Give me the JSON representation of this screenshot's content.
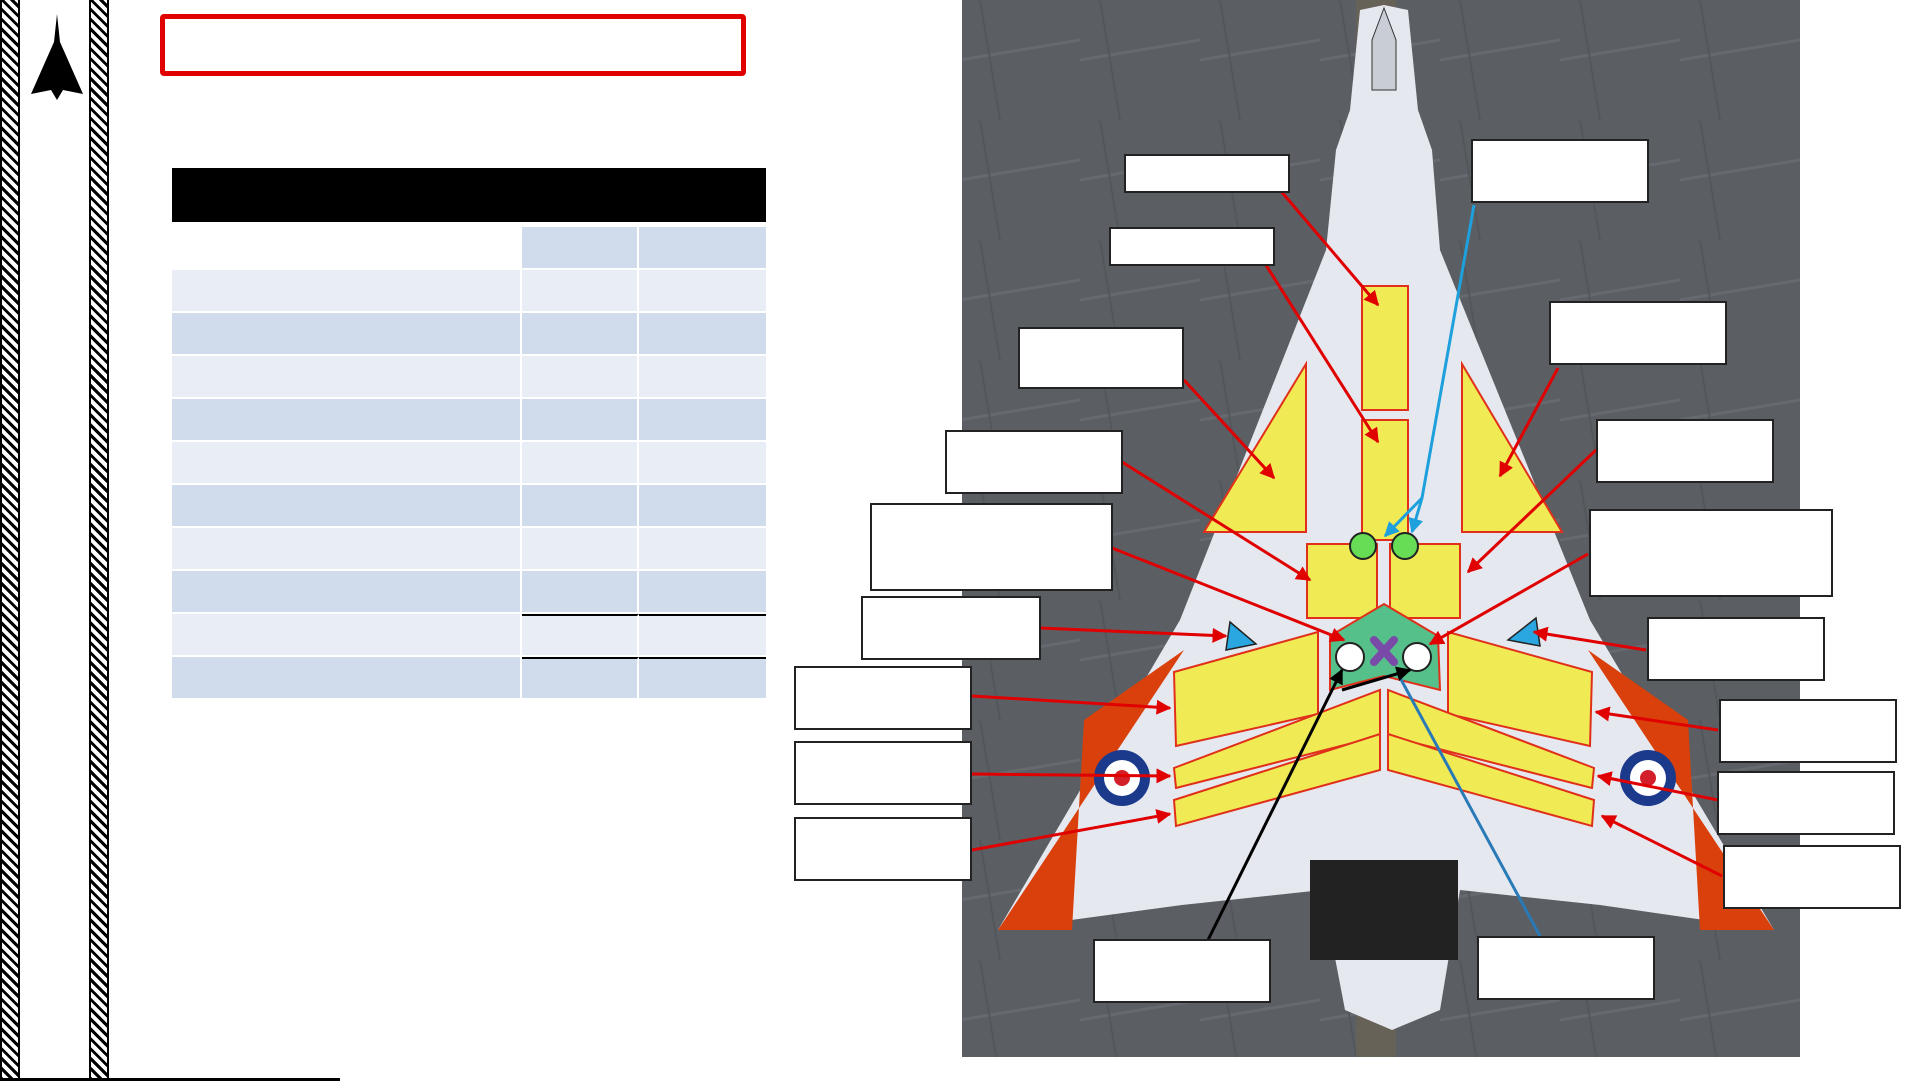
{
  "colors": {
    "frame_red": "#e00000",
    "table_header": "#000000",
    "row_light": "#e9edf5",
    "row_dark": "#d0dcec",
    "tank_fill": "#f0ea55",
    "tank_border": "#e0301a",
    "center_tank": "#55c08a",
    "callout_arrow": "#e00000",
    "sensor_arrow_light": "#1ea0dc",
    "sensor_arrow_dark": "#2a7ab8",
    "marker_green": "#66dd55",
    "marker_purple": "#7a4aa8",
    "marker_blue": "#2aa7e0"
  },
  "icons": {
    "logo": "delta-wing-jet-icon",
    "marker_x": "purple-x-marker-icon",
    "triangle": "blue-triangle-marker-icon"
  },
  "header": {
    "title": ""
  },
  "table": {
    "header_text": "",
    "columns": [
      "",
      "",
      ""
    ],
    "rows": [
      [
        "",
        "",
        ""
      ],
      [
        "",
        "",
        ""
      ],
      [
        "",
        "",
        ""
      ],
      [
        "",
        "",
        ""
      ],
      [
        "",
        "",
        ""
      ],
      [
        "",
        "",
        ""
      ],
      [
        "",
        "",
        ""
      ],
      [
        "",
        "",
        ""
      ],
      [
        "",
        "",
        ""
      ],
      [
        "",
        "",
        ""
      ]
    ]
  },
  "callouts": [
    "",
    "",
    "",
    "",
    "",
    "",
    "",
    "",
    "",
    "",
    "",
    "",
    "",
    "",
    "",
    "",
    "",
    "",
    "",
    ""
  ]
}
